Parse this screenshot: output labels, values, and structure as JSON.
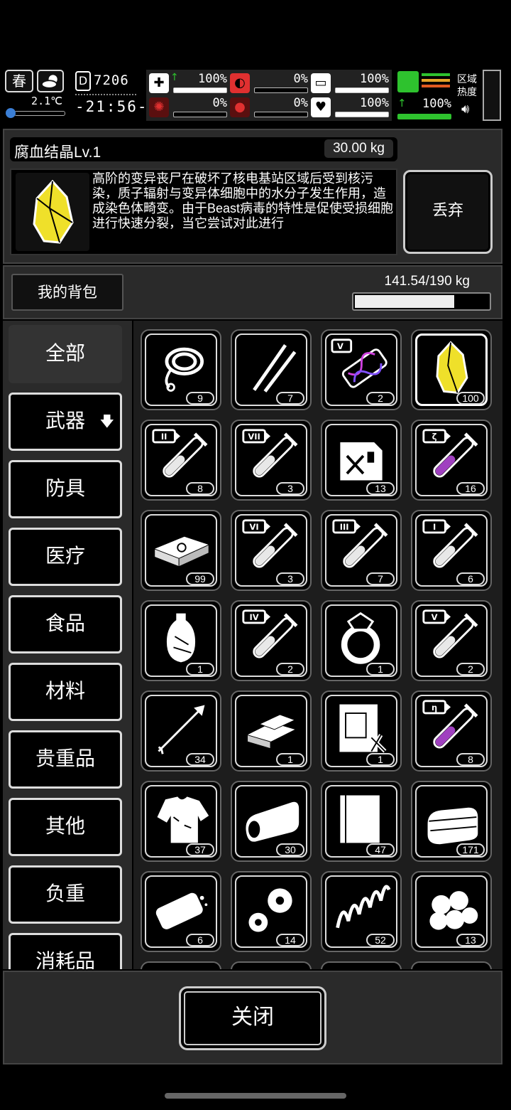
{
  "hud": {
    "season": "春",
    "temperature": "2.1℃",
    "day": "7206",
    "time": "-21:56-",
    "vitals": [
      {
        "name": "health-icon",
        "value": "100%",
        "level": 1.0,
        "color": "#ffffff",
        "up": true
      },
      {
        "name": "stomach-icon",
        "value": "0%",
        "level": 0.0,
        "color": "#e03030",
        "up": false
      },
      {
        "name": "bandage-icon",
        "value": "100%",
        "level": 1.0,
        "color": "#ffffff",
        "up": false
      },
      {
        "name": "brain-icon",
        "value": "0%",
        "level": 0.0,
        "color": "#e03030",
        "up": false
      },
      {
        "name": "blood-icon",
        "value": "0%",
        "level": 0.0,
        "color": "#e03030",
        "up": false
      },
      {
        "name": "heart-icon",
        "value": "100%",
        "level": 1.0,
        "color": "#ffffff",
        "up": false
      }
    ],
    "stamina": "100%",
    "region_heat_label": "区域热度"
  },
  "item": {
    "name": "腐血结晶Lv.1",
    "weight": "30.00 kg",
    "description": "高阶的变异丧尸在破坏了核电基站区域后受到核污染，质子辐射与变异体细胞中的水分子发生作用，造成染色体畸变。由于Beast病毒的特性是促使受损细胞进行快速分裂，当它尝试对此进行",
    "discard_label": "丢弃"
  },
  "backpack": {
    "label": "我的背包",
    "capacity": "141.54/190 kg",
    "fill_fraction": 0.745
  },
  "categories": [
    {
      "label": "全部",
      "selected": true
    },
    {
      "label": "武器",
      "arrow": "🡇"
    },
    {
      "label": "防具"
    },
    {
      "label": "医疗"
    },
    {
      "label": "食品"
    },
    {
      "label": "材料"
    },
    {
      "label": "贵重品"
    },
    {
      "label": "其他"
    },
    {
      "label": "负重"
    },
    {
      "label": "消耗品"
    }
  ],
  "items": [
    {
      "icon": "rope-icon",
      "count": "9"
    },
    {
      "icon": "lockpick-icon",
      "count": "7"
    },
    {
      "icon": "dna-vial-icon",
      "count": "2",
      "tier": "V"
    },
    {
      "icon": "crystal-icon",
      "count": "100",
      "selected": true
    },
    {
      "icon": "test-tube-icon",
      "count": "8",
      "tier": "II"
    },
    {
      "icon": "test-tube-icon",
      "count": "3",
      "tier": "VII"
    },
    {
      "icon": "fuel-can-icon",
      "count": "13"
    },
    {
      "icon": "purple-tube-icon",
      "count": "16",
      "tier": "ζ"
    },
    {
      "icon": "cash-stack-icon",
      "count": "99"
    },
    {
      "icon": "test-tube-icon",
      "count": "3",
      "tier": "VI"
    },
    {
      "icon": "test-tube-icon",
      "count": "7",
      "tier": "III"
    },
    {
      "icon": "test-tube-icon",
      "count": "6",
      "tier": "I"
    },
    {
      "icon": "vase-icon",
      "count": "1"
    },
    {
      "icon": "test-tube-icon",
      "count": "2",
      "tier": "IV"
    },
    {
      "icon": "ring-icon",
      "count": "1"
    },
    {
      "icon": "test-tube-icon",
      "count": "2",
      "tier": "V"
    },
    {
      "icon": "arrow-icon",
      "count": "34"
    },
    {
      "icon": "gold-bars-icon",
      "count": "1"
    },
    {
      "icon": "blueprint-icon",
      "count": "1"
    },
    {
      "icon": "purple-tube-icon",
      "count": "8",
      "tier": "η"
    },
    {
      "icon": "torn-shirt-icon",
      "count": "37"
    },
    {
      "icon": "cloth-roll-icon",
      "count": "30"
    },
    {
      "icon": "paper-sheets-icon",
      "count": "47"
    },
    {
      "icon": "folded-cloth-icon",
      "count": "171"
    },
    {
      "icon": "bread-icon",
      "count": "6"
    },
    {
      "icon": "gears-icon",
      "count": "14"
    },
    {
      "icon": "spring-icon",
      "count": "52"
    },
    {
      "icon": "cotton-icon",
      "count": "13"
    }
  ],
  "footer": {
    "close_label": "关闭"
  }
}
